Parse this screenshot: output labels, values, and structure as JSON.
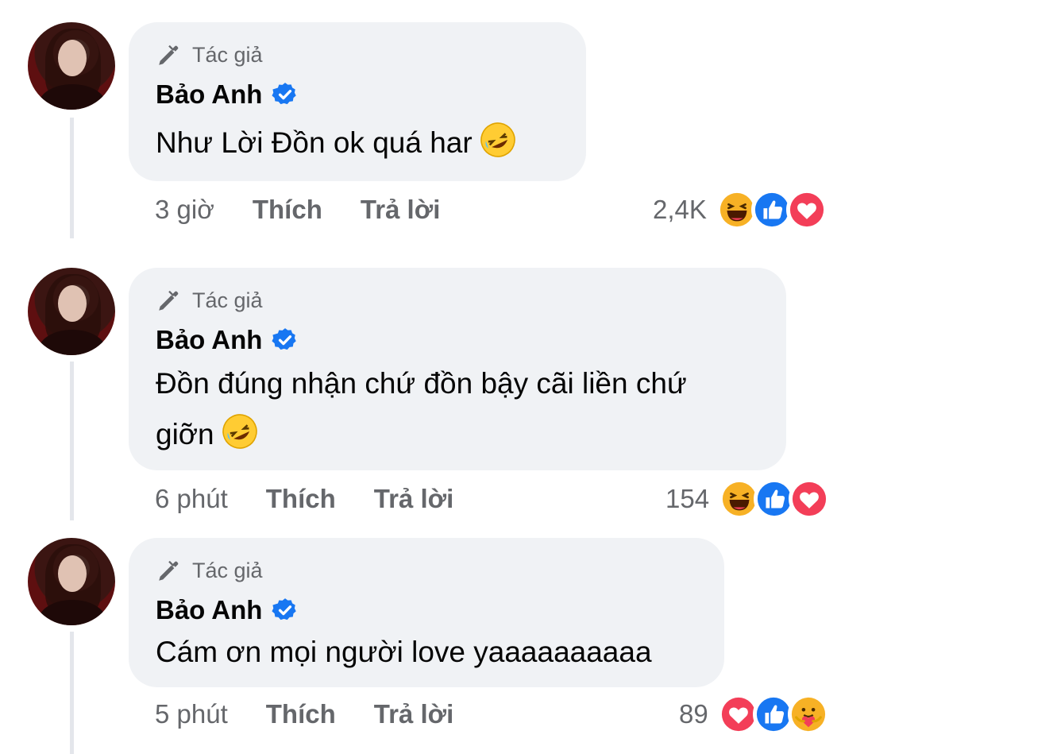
{
  "comments": [
    {
      "author_tag": "Tác giả",
      "name": "Bảo Anh",
      "text_lines": [
        "Như Lời Đồn ok quá har"
      ],
      "text_emoji": "rolling-laughing",
      "time": "3 giờ",
      "like_label": "Thích",
      "reply_label": "Trả lời",
      "reaction_count": "2,4K",
      "reactions": [
        "haha-icon",
        "like-icon",
        "love-icon"
      ]
    },
    {
      "author_tag": "Tác giả",
      "name": "Bảo Anh",
      "text_lines": [
        "Đồn đúng nhận chứ đồn bậy cãi liền chứ",
        "giỡn"
      ],
      "text_emoji": "rolling-laughing",
      "time": "6 phút",
      "like_label": "Thích",
      "reply_label": "Trả lời",
      "reaction_count": "154",
      "reactions": [
        "haha-icon",
        "like-icon",
        "love-icon"
      ]
    },
    {
      "author_tag": "Tác giả",
      "name": "Bảo Anh",
      "text_lines": [
        "Cám ơn mọi người love yaaaaaaaaaa"
      ],
      "text_emoji": "",
      "time": "5 phút",
      "like_label": "Thích",
      "reply_label": "Trả lời",
      "reaction_count": "89",
      "reactions": [
        "love-icon",
        "like-icon",
        "care-icon"
      ]
    }
  ],
  "colors": {
    "bubble": "#f0f2f5",
    "meta_text": "#65676b",
    "verified": "#1877f2",
    "like_blue": "#1877f2",
    "love_red": "#f33e58",
    "haha_yellow": "#f7b125"
  }
}
